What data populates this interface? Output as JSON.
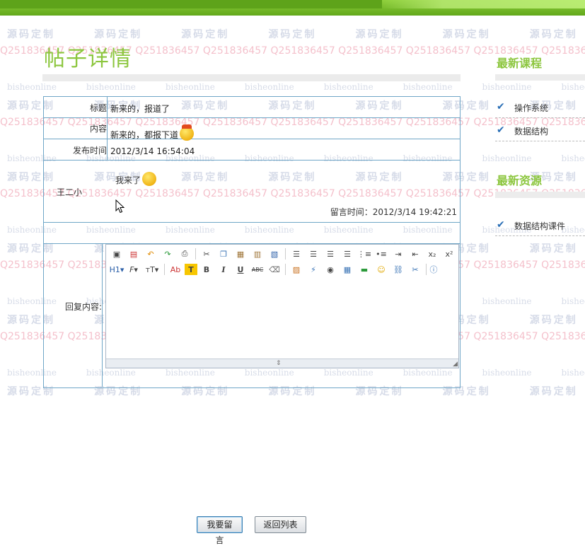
{
  "page": {
    "title": "帖子详情"
  },
  "watermark": {
    "text_a": "源码定制",
    "text_b": "Q251836457",
    "text_c": "bisheonline"
  },
  "post": {
    "title_label": "标题",
    "title_value": "新来的，报道了",
    "content_label": "内容",
    "content_value": "新来的，都报下道",
    "time_label": "发布时间",
    "time_value": "2012/3/14 16:54:04"
  },
  "reply": {
    "author": "王二小",
    "text": "我来了",
    "time_label": "留言时间：",
    "time_value": "2012/3/14 19:42:21"
  },
  "form": {
    "label": "回复内容:",
    "submit_label": "我要留言",
    "back_label": "返回列表",
    "toolbar_row1": [
      "source-icon",
      "preview-icon",
      "undo-icon",
      "redo-icon",
      "print-icon",
      "cut-icon",
      "copy-icon",
      "paste-icon",
      "paste-text-icon",
      "paste-word-icon",
      "align-left-icon",
      "align-center-icon",
      "align-right-icon",
      "justify-icon",
      "ordered-list-icon",
      "unordered-list-icon",
      "indent-icon",
      "outdent-icon",
      "subscript-icon",
      "superscript-icon"
    ],
    "toolbar_row2": [
      "heading-icon",
      "font-family-icon",
      "font-size-icon",
      "font-color-icon",
      "highlight-icon",
      "bold-icon",
      "italic-icon",
      "underline-icon",
      "strikethrough-icon",
      "remove-format-icon",
      "image-icon",
      "flash-icon",
      "media-icon",
      "table-icon",
      "hr-icon",
      "emoticon-icon",
      "link-icon",
      "unlink-icon",
      "about-icon"
    ],
    "tb_text": {
      "h1": "H1",
      "ff": "F",
      "fs": "тT",
      "ab": "Ab",
      "t": "T",
      "b": "B",
      "i": "I",
      "u": "U",
      "abc": "ABC",
      "sub": "x₂",
      "sup": "x²"
    }
  },
  "sidebar": {
    "courses_heading": "最新课程",
    "courses": [
      "操作系统",
      "数据结构"
    ],
    "resources_heading": "最新资源",
    "resources": [
      "数据结构课件"
    ]
  }
}
